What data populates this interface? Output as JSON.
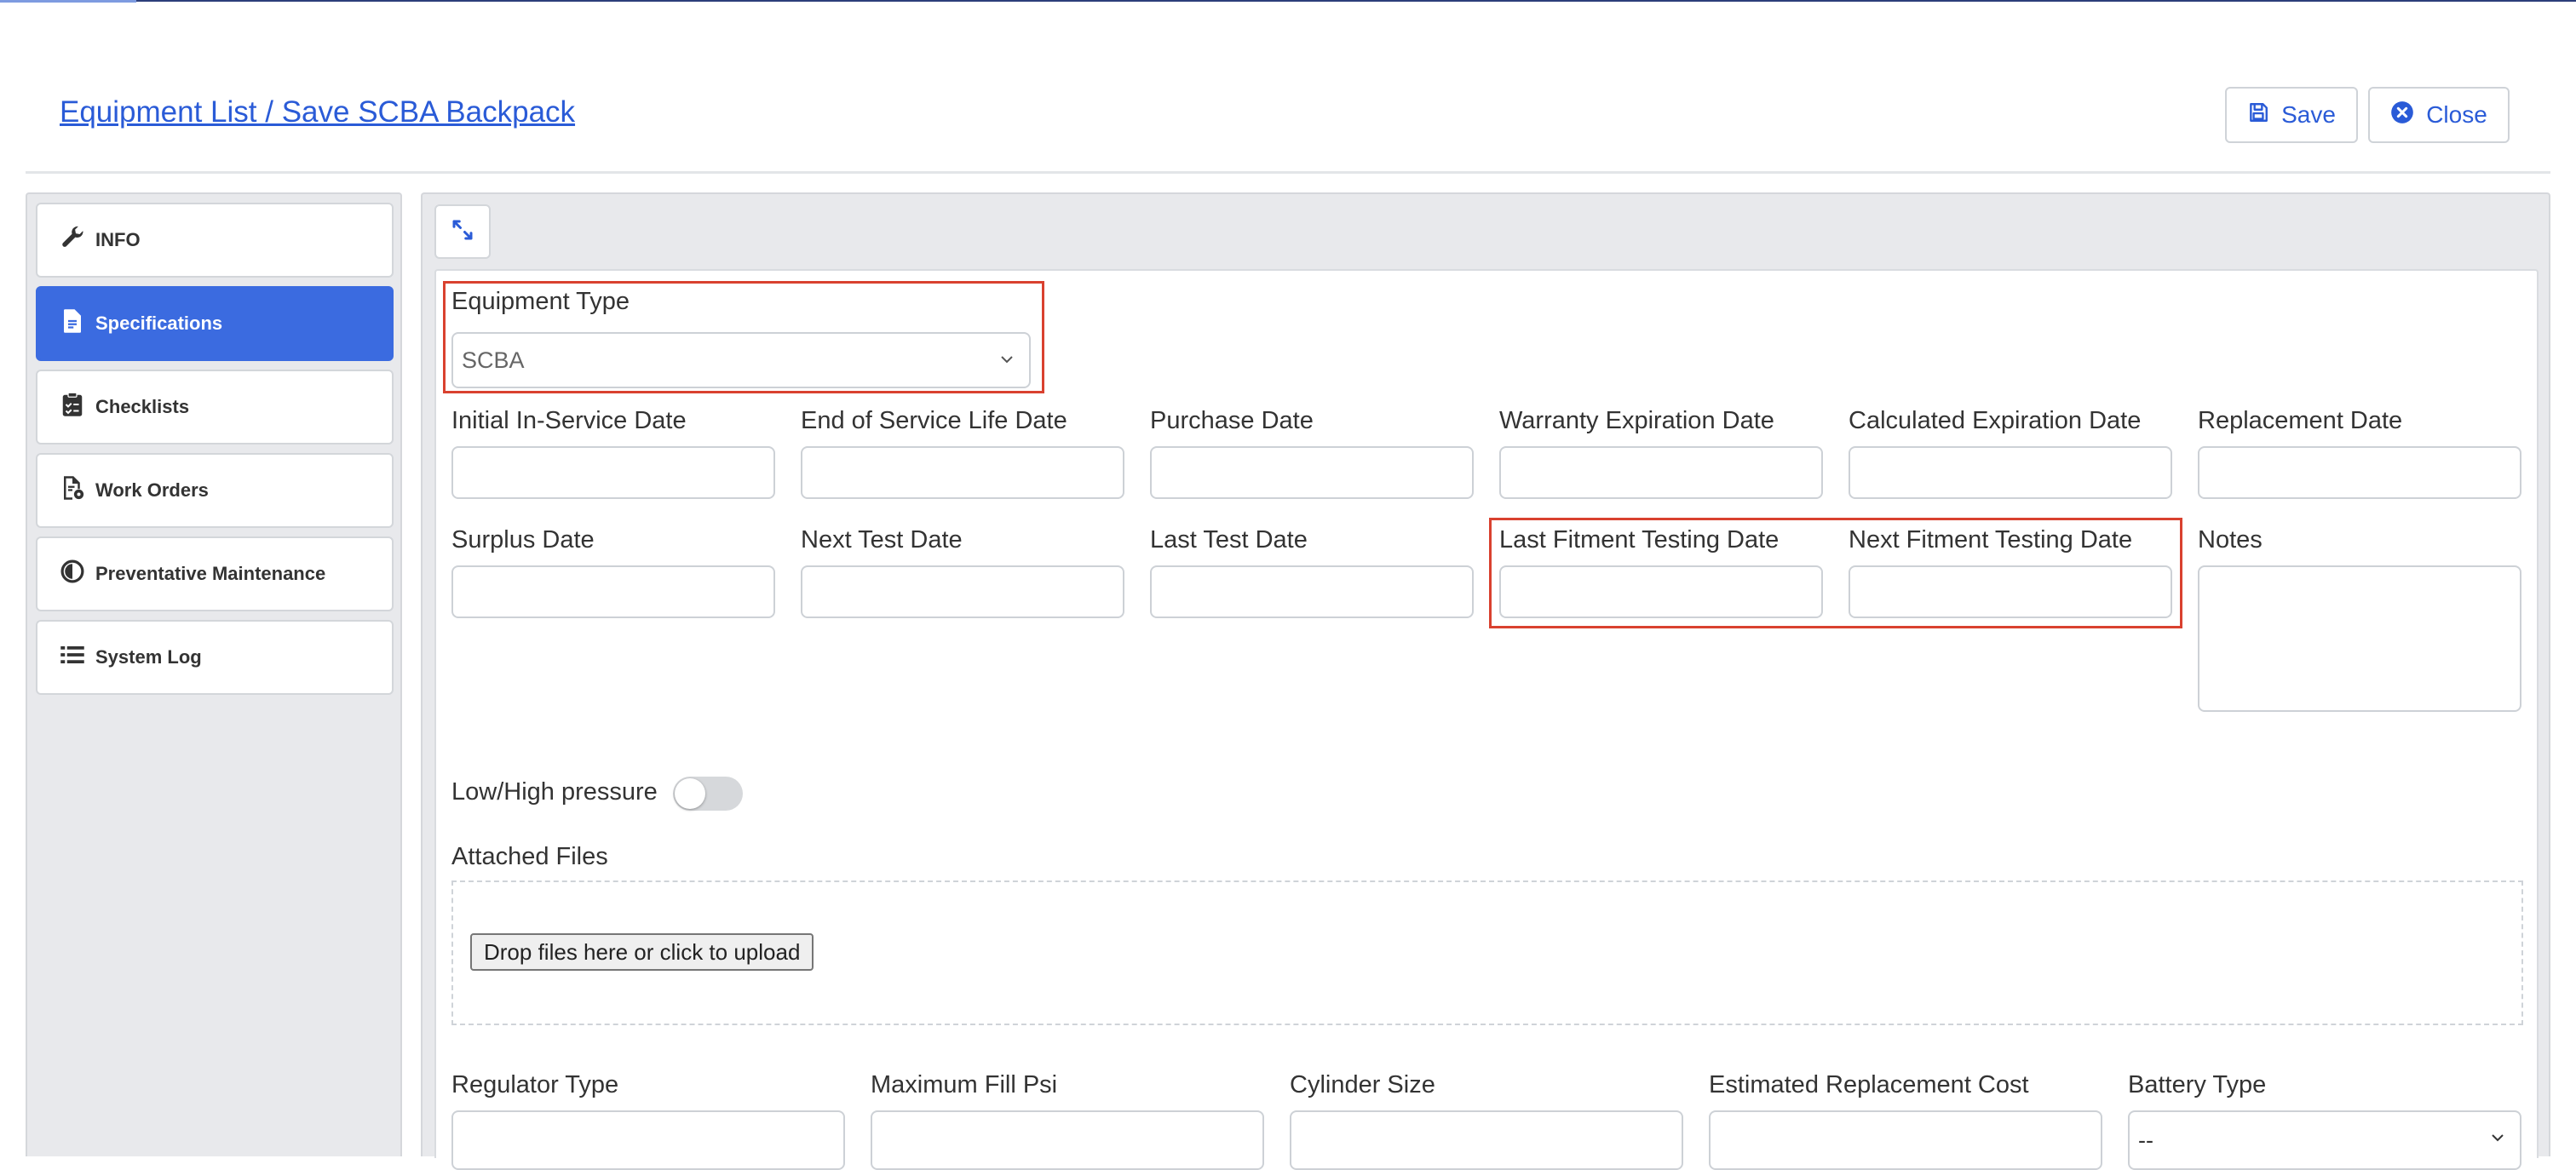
{
  "header": {
    "title": "Equipment List / Save SCBA Backpack",
    "save_label": "Save",
    "close_label": "Close"
  },
  "sidebar": {
    "items": [
      {
        "label": "INFO",
        "icon": "wrench-icon",
        "active": false
      },
      {
        "label": "Specifications",
        "icon": "document-icon",
        "active": true
      },
      {
        "label": "Checklists",
        "icon": "clipboard-check-icon",
        "active": false
      },
      {
        "label": "Work Orders",
        "icon": "file-gear-icon",
        "active": false
      },
      {
        "label": "Preventative Maintenance",
        "icon": "circle-half-icon",
        "active": false
      },
      {
        "label": "System Log",
        "icon": "list-icon",
        "active": false
      }
    ]
  },
  "form": {
    "equipment_type": {
      "label": "Equipment Type",
      "value": "SCBA"
    },
    "row1": [
      {
        "label": "Initial In-Service Date",
        "value": ""
      },
      {
        "label": "End of Service Life Date",
        "value": ""
      },
      {
        "label": "Purchase Date",
        "value": ""
      },
      {
        "label": "Warranty Expiration Date",
        "value": ""
      },
      {
        "label": "Calculated Expiration Date",
        "value": ""
      },
      {
        "label": "Replacement Date",
        "value": ""
      }
    ],
    "row2": [
      {
        "label": "Surplus Date",
        "value": ""
      },
      {
        "label": "Next Test Date",
        "value": ""
      },
      {
        "label": "Last Test Date",
        "value": ""
      },
      {
        "label": "Last Fitment Testing Date",
        "value": ""
      },
      {
        "label": "Next Fitment Testing Date",
        "value": ""
      }
    ],
    "notes": {
      "label": "Notes",
      "value": ""
    },
    "pressure_toggle": {
      "label": "Low/High pressure",
      "on": false
    },
    "attached_files": {
      "label": "Attached Files",
      "upload_label": "Drop files here or click to upload"
    },
    "row3": [
      {
        "label": "Regulator Type",
        "value": ""
      },
      {
        "label": "Maximum Fill Psi",
        "value": ""
      },
      {
        "label": "Cylinder Size",
        "value": ""
      },
      {
        "label": "Estimated Replacement Cost",
        "value": ""
      }
    ],
    "battery_type": {
      "label": "Battery Type",
      "value": "--"
    }
  },
  "colors": {
    "accent": "#3b6be0",
    "link": "#2a5bd7",
    "highlight": "#d9412f"
  }
}
